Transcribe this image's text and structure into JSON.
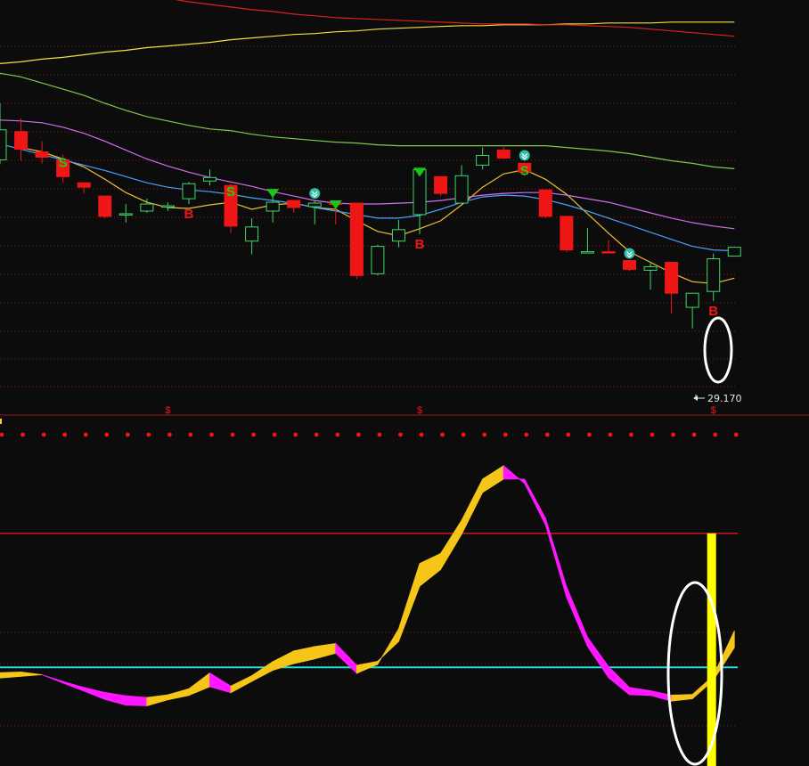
{
  "colors": {
    "background": "#0c0c0c",
    "grid": "#8a1818",
    "up_candle": "#3fd66a",
    "down_candle": "#f01616",
    "ma_short": "#f0c030",
    "ma_20": "#4aa0ff",
    "ma_30": "#d070f0",
    "ma_60": "#7ec850",
    "ma_120": "#f0e040",
    "ma_250": "#e02020",
    "buy_signal": "#f01616",
    "sell_signal": "#18d018",
    "osc_up": "#f5c518",
    "osc_down": "#ff18ff",
    "osc_spike": "#ffff00",
    "level_upper": "#e01818",
    "level_lower": "#20e0e0",
    "highlight_ellipse": "#ffffff"
  },
  "chart_data": [
    {
      "type": "candlestick",
      "title": "",
      "grid": true,
      "ylim": [
        28.55,
        33.27
      ],
      "low_price_label": "29.170",
      "candles": [
        {
          "o": 31.46,
          "h": 32.1,
          "l": 31.41,
          "c": 31.8
        },
        {
          "o": 31.78,
          "h": 31.93,
          "l": 31.45,
          "c": 31.58
        },
        {
          "o": 31.55,
          "h": 31.67,
          "l": 31.42,
          "c": 31.49
        },
        {
          "o": 31.46,
          "h": 31.52,
          "l": 31.2,
          "c": 31.27
        },
        {
          "o": 31.2,
          "h": 31.2,
          "l": 31.08,
          "c": 31.15
        },
        {
          "o": 31.05,
          "h": 31.05,
          "l": 30.8,
          "c": 30.82
        },
        {
          "o": 30.85,
          "h": 30.96,
          "l": 30.75,
          "c": 30.85
        },
        {
          "o": 30.88,
          "h": 31.02,
          "l": 30.86,
          "c": 30.96
        },
        {
          "o": 30.94,
          "h": 30.98,
          "l": 30.88,
          "c": 30.94
        },
        {
          "o": 31.02,
          "h": 31.21,
          "l": 30.96,
          "c": 31.19
        },
        {
          "o": 31.22,
          "h": 31.35,
          "l": 31.17,
          "c": 31.26
        },
        {
          "o": 31.17,
          "h": 31.19,
          "l": 30.63,
          "c": 30.71
        },
        {
          "o": 30.54,
          "h": 30.8,
          "l": 30.39,
          "c": 30.7
        },
        {
          "o": 30.88,
          "h": 31.11,
          "l": 30.75,
          "c": 30.98
        },
        {
          "o": 31.0,
          "h": 31.0,
          "l": 30.86,
          "c": 30.92
        },
        {
          "o": 30.93,
          "h": 31.0,
          "l": 30.73,
          "c": 30.97
        },
        {
          "o": 30.97,
          "h": 30.98,
          "l": 30.73,
          "c": 30.96
        },
        {
          "o": 30.97,
          "h": 30.97,
          "l": 30.11,
          "c": 30.15
        },
        {
          "o": 30.17,
          "h": 30.5,
          "l": 30.15,
          "c": 30.48
        },
        {
          "o": 30.54,
          "h": 30.78,
          "l": 30.47,
          "c": 30.67
        },
        {
          "o": 30.84,
          "h": 31.35,
          "l": 30.62,
          "c": 31.35
        },
        {
          "o": 31.27,
          "h": 31.27,
          "l": 31.05,
          "c": 31.08
        },
        {
          "o": 30.97,
          "h": 31.4,
          "l": 30.96,
          "c": 31.28
        },
        {
          "o": 31.4,
          "h": 31.6,
          "l": 31.35,
          "c": 31.51
        },
        {
          "o": 31.57,
          "h": 31.62,
          "l": 31.47,
          "c": 31.48
        },
        {
          "o": 31.42,
          "h": 31.43,
          "l": 31.28,
          "c": 31.32
        },
        {
          "o": 31.12,
          "h": 31.12,
          "l": 30.8,
          "c": 30.82
        },
        {
          "o": 30.82,
          "h": 30.82,
          "l": 30.42,
          "c": 30.44
        },
        {
          "o": 30.42,
          "h": 30.69,
          "l": 30.41,
          "c": 30.42
        },
        {
          "o": 30.42,
          "h": 30.55,
          "l": 30.4,
          "c": 30.41
        },
        {
          "o": 30.32,
          "h": 30.32,
          "l": 30.2,
          "c": 30.22
        },
        {
          "o": 30.21,
          "h": 30.29,
          "l": 29.99,
          "c": 30.25
        },
        {
          "o": 30.3,
          "h": 30.3,
          "l": 29.72,
          "c": 29.95
        },
        {
          "o": 29.79,
          "h": 29.92,
          "l": 29.55,
          "c": 29.95
        },
        {
          "o": 29.97,
          "h": 30.4,
          "l": 29.86,
          "c": 30.34
        },
        {
          "o": 30.37,
          "h": 30.47,
          "l": 30.37,
          "c": 30.47
        }
      ],
      "moving_averages": [
        {
          "values": [
            null,
            31.6,
            31.55,
            31.47,
            31.38,
            31.24,
            31.09,
            30.98,
            30.92,
            30.91,
            30.95,
            30.98,
            30.9,
            30.95,
            30.97,
            30.92,
            30.9,
            30.77,
            30.65,
            30.6,
            30.68,
            30.77,
            30.95,
            31.15,
            31.3,
            31.35,
            31.24,
            31.07,
            30.85,
            30.63,
            30.42,
            30.3,
            30.18,
            30.08,
            30.06,
            30.12
          ]
        },
        {
          "values": [
            31.64,
            31.58,
            31.52,
            31.46,
            31.4,
            31.34,
            31.27,
            31.2,
            31.15,
            31.12,
            31.1,
            31.07,
            31.03,
            31.0,
            30.97,
            30.92,
            30.88,
            30.84,
            30.8,
            30.8,
            30.83,
            30.9,
            30.98,
            31.04,
            31.06,
            31.05,
            31.01,
            30.95,
            30.88,
            30.8,
            30.72,
            30.64,
            30.56,
            30.48,
            30.44,
            30.43
          ]
        },
        {
          "values": [
            31.91,
            31.9,
            31.88,
            31.83,
            31.76,
            31.67,
            31.57,
            31.47,
            31.39,
            31.32,
            31.26,
            31.21,
            31.16,
            31.1,
            31.05,
            31.0,
            30.97,
            30.96,
            30.96,
            30.97,
            30.98,
            31.0,
            31.03,
            31.06,
            31.08,
            31.09,
            31.09,
            31.06,
            31.02,
            30.98,
            30.92,
            30.86,
            30.8,
            30.75,
            30.71,
            30.68
          ]
        },
        {
          "values": [
            32.44,
            32.4,
            32.33,
            32.26,
            32.19,
            32.1,
            32.02,
            31.95,
            31.9,
            31.85,
            31.81,
            31.79,
            31.75,
            31.72,
            31.7,
            31.68,
            31.66,
            31.65,
            31.63,
            31.62,
            31.62,
            31.62,
            31.62,
            31.62,
            31.62,
            31.62,
            31.62,
            31.6,
            31.58,
            31.56,
            31.53,
            31.49,
            31.45,
            31.42,
            31.38,
            31.36
          ]
        },
        {
          "values": [
            32.55,
            32.57,
            32.6,
            32.62,
            32.65,
            32.68,
            32.7,
            32.73,
            32.75,
            32.77,
            32.79,
            32.82,
            32.84,
            32.86,
            32.88,
            32.89,
            32.91,
            32.92,
            32.94,
            32.95,
            32.96,
            32.97,
            32.98,
            32.98,
            32.99,
            32.99,
            32.99,
            33.0,
            33.0,
            33.01,
            33.01,
            33.01,
            33.02,
            33.02,
            33.02,
            33.02
          ]
        },
        {
          "values": [
            33.58,
            33.56,
            33.52,
            33.48,
            33.44,
            33.4,
            33.36,
            33.33,
            33.29,
            33.25,
            33.22,
            33.19,
            33.16,
            33.14,
            33.11,
            33.09,
            33.07,
            33.06,
            33.05,
            33.04,
            33.03,
            33.02,
            33.01,
            33.0,
            33.0,
            33.0,
            32.99,
            32.99,
            32.98,
            32.97,
            32.96,
            32.94,
            32.92,
            32.9,
            32.88,
            32.86
          ]
        }
      ],
      "signals": [
        {
          "index": 3,
          "text": "S",
          "kind": "sell"
        },
        {
          "index": 9,
          "text": "B",
          "kind": "buy"
        },
        {
          "index": 11,
          "text": "S",
          "kind": "sell"
        },
        {
          "index": 20,
          "text": "B",
          "kind": "buy"
        },
        {
          "index": 25,
          "text": "S",
          "kind": "sell"
        },
        {
          "index": 34,
          "text": "B",
          "kind": "buy"
        }
      ],
      "down_triangles": [
        13,
        16,
        20
      ],
      "chevron_badges": [
        15,
        25,
        30
      ],
      "bottom_marks": [
        {
          "index": 8,
          "text": "$"
        },
        {
          "index": 20,
          "text": "$"
        },
        {
          "index": 34,
          "text": "$"
        }
      ]
    },
    {
      "type": "area",
      "title": "",
      "ylim": [
        0,
        100
      ],
      "upper_level": 70,
      "lower_level": 30,
      "spike_index": 34,
      "spike_value": 70,
      "x": [
        0,
        1,
        2,
        3,
        4,
        5,
        6,
        7,
        8,
        9,
        10,
        11,
        12,
        13,
        14,
        15,
        16,
        17,
        18,
        19,
        20,
        21,
        22,
        23,
        24,
        25,
        26,
        27,
        28,
        29,
        30,
        31,
        32,
        33,
        34,
        35
      ],
      "series": [
        {
          "values": [
            26.8,
            27.3,
            27.8,
            25.3,
            22.9,
            20.4,
            18.7,
            18.5,
            20.3,
            21.6,
            24.2,
            22.4,
            25.8,
            29.1,
            31.1,
            32.5,
            34.2,
            28.2,
            30.9,
            41.5,
            61.0,
            64.0,
            73.9,
            86.2,
            90.2,
            84.9,
            72.5,
            50.9,
            36.2,
            26.9,
            21.8,
            21.6,
            19.9,
            20.6,
            26.1,
            35.9
          ]
        },
        {
          "values": [
            28.4,
            28.6,
            27.8,
            25.8,
            24.0,
            22.5,
            21.5,
            21.0,
            21.8,
            23.6,
            28.3,
            24.4,
            27.5,
            31.7,
            34.9,
            36.2,
            37.1,
            30.6,
            31.8,
            37.7,
            54.2,
            59.2,
            69.7,
            82.2,
            86.2,
            86.2,
            74.5,
            54.1,
            39.0,
            30.3,
            24.0,
            23.0,
            21.7,
            21.9,
            27.5,
            40.9
          ]
        }
      ]
    }
  ]
}
